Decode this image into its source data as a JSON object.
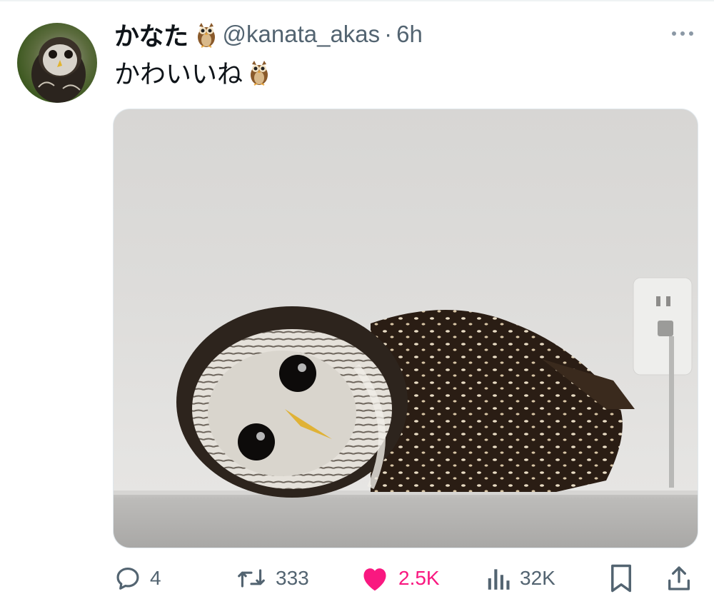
{
  "tweet": {
    "display_name": "かなた",
    "handle": "@kanata_akas",
    "separator": "·",
    "time": "6h",
    "text": "かわいいね",
    "emoji": "owl-emoji",
    "more_icon": "more-horizontal-icon"
  },
  "media": {
    "kind": "photo",
    "subject_icon": "owl-photo"
  },
  "actions": {
    "reply": {
      "icon": "reply-icon",
      "count": "4"
    },
    "retweet": {
      "icon": "retweet-icon",
      "count": "333"
    },
    "like": {
      "icon": "heart-icon",
      "count": "2.5K",
      "active": true,
      "color": "#f91880"
    },
    "views": {
      "icon": "views-icon",
      "count": "32K"
    },
    "bookmark": {
      "icon": "bookmark-icon"
    },
    "share": {
      "icon": "share-icon"
    }
  },
  "colors": {
    "text": "#0f1419",
    "secondary": "#536471",
    "like": "#f91880"
  }
}
